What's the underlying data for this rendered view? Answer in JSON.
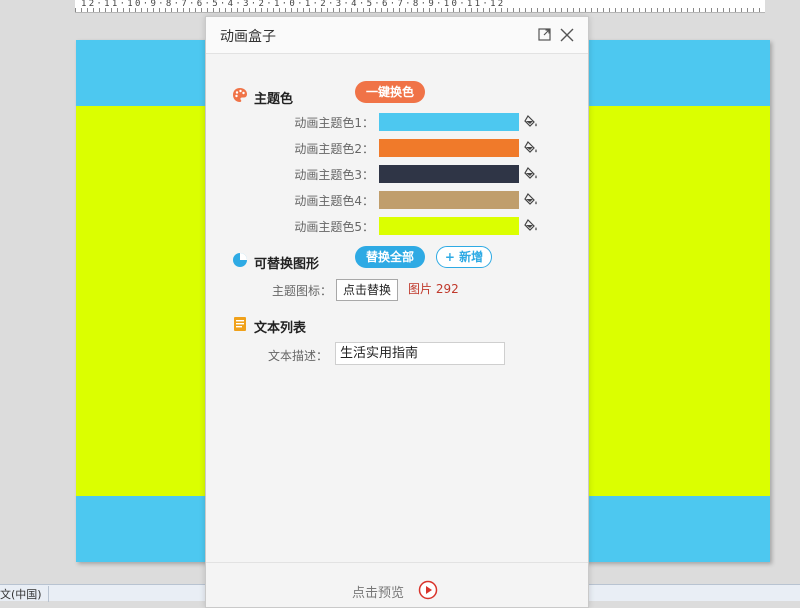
{
  "ruler": {
    "marks": "12·11·10·9·8·7·6·5·4·3·2·1·0·1·2·3·4·5·6·7·8·9·10·11·12"
  },
  "slide": {
    "band_colors": [
      "#4dc8f0",
      "#dbff00",
      "#4dc8f0"
    ]
  },
  "status_bar": {
    "language": "文(中国)"
  },
  "dialog": {
    "title": "动画盒子",
    "theme_section": {
      "title": "主题色",
      "one_click_button": "一键换色",
      "colors": [
        {
          "label": "动画主题色1：",
          "color": "#4dc8f0"
        },
        {
          "label": "动画主题色2：",
          "color": "#f07a2a"
        },
        {
          "label": "动画主题色3：",
          "color": "#2f3546"
        },
        {
          "label": "动画主题色4：",
          "color": "#c09e6c"
        },
        {
          "label": "动画主题色5：",
          "color": "#dbff00"
        }
      ]
    },
    "shape_section": {
      "title": "可替换图形",
      "replace_all_button": "替换全部",
      "add_button": "+ 新增",
      "icon_label": "主题图标：",
      "click_replace_button": "点击替换",
      "image_ref": "图片 292"
    },
    "text_section": {
      "title": "文本列表",
      "desc_label": "文本描述：",
      "desc_value": "生活实用指南"
    },
    "footer": {
      "preview_label": "点击预览"
    }
  }
}
